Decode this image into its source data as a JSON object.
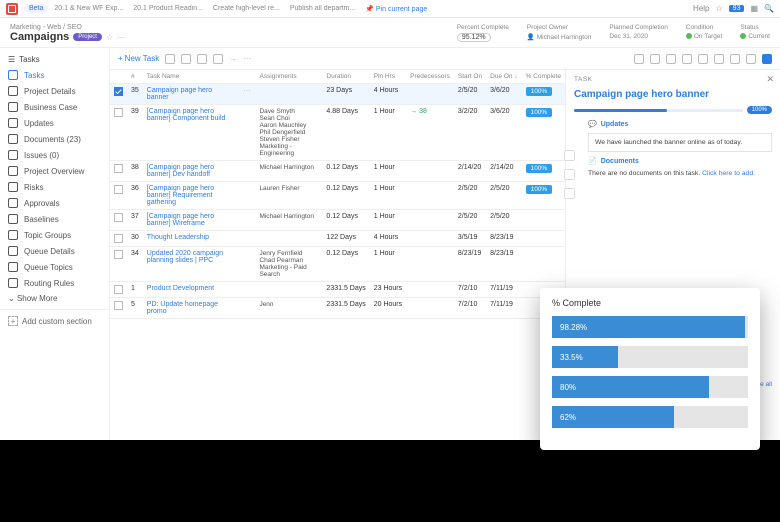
{
  "topbar": {
    "beta": "Beta",
    "tabs": [
      "20.1 & New WF Exp...",
      "20.1 Product Readin...",
      "Create high-level re...",
      "Publish all departm..."
    ],
    "pin": "Pin current page",
    "help": "Help",
    "notif_count": "93"
  },
  "header": {
    "crumbs": "Marketing - Web / SEO",
    "title": "Campaigns",
    "project_chip": "Project",
    "stats": {
      "percent_label": "Percent Complete",
      "percent_value": "95.12%",
      "owner_label": "Project Owner",
      "owner_value": "Michael Harrington",
      "planned_label": "Planned Completion",
      "planned_value": "Dec 31, 2020",
      "condition_label": "Condition",
      "condition_value": "On Target",
      "status_label": "Status",
      "status_value": "Current"
    }
  },
  "sidebar_head": "Tasks",
  "sidebar": {
    "items": [
      {
        "label": "Tasks",
        "active": true
      },
      {
        "label": "Project Details"
      },
      {
        "label": "Business Case"
      },
      {
        "label": "Updates"
      },
      {
        "label": "Documents (23)"
      },
      {
        "label": "Issues (0)"
      },
      {
        "label": "Project Overview"
      },
      {
        "label": "Risks"
      },
      {
        "label": "Approvals"
      },
      {
        "label": "Baselines"
      },
      {
        "label": "Topic Groups"
      },
      {
        "label": "Queue Details"
      },
      {
        "label": "Queue Topics"
      },
      {
        "label": "Routing Rules"
      }
    ],
    "show_more": "Show More",
    "add_section": "Add custom section"
  },
  "toolbar": {
    "new_task": "New Task"
  },
  "columns": [
    "",
    "#",
    "Task Name",
    "",
    "Assignments",
    "Duration",
    "Pln Hrs",
    "Predecessors",
    "Start On",
    "Due On ↓",
    "% Complete"
  ],
  "rows": [
    {
      "checked": true,
      "num": "35",
      "name": "Campaign page hero banner",
      "assign": "",
      "dur": "23 Days",
      "pln": "4 Hours",
      "pred": "",
      "start": "2/5/20",
      "due": "3/6/20",
      "pct": "100%"
    },
    {
      "num": "39",
      "name": "[Campaign page hero banner] Component build",
      "assign": "Dave Smyth · Sean Choi · Aaron Mauchley · Phil Dengerfield · Steven Fisher · Marketing - Engineering",
      "dur": "4.88 Days",
      "pln": "1 Hour",
      "pred": "→ 38",
      "start": "3/2/20",
      "due": "3/6/20",
      "pct": "100%"
    },
    {
      "num": "38",
      "name": "[Campaign page hero banner] Dev handoff",
      "assign": "Michael Harrington",
      "dur": "0.12 Days",
      "pln": "1 Hour",
      "pred": "",
      "start": "2/14/20",
      "due": "2/14/20",
      "pct": "100%"
    },
    {
      "num": "36",
      "name": "[Campaign page hero banner] Requirement gathering",
      "assign": "Lauren Fisher",
      "dur": "0.12 Days",
      "pln": "1 Hour",
      "pred": "",
      "start": "2/5/20",
      "due": "2/5/20",
      "pct": "100%"
    },
    {
      "num": "37",
      "name": "[Campaign page hero banner] Wireframe",
      "assign": "Michael Harrington",
      "dur": "0.12 Days",
      "pln": "1 Hour",
      "pred": "",
      "start": "2/5/20",
      "due": "2/5/20",
      "pct": ""
    },
    {
      "num": "30",
      "name": "Thought Leadership",
      "assign": "",
      "dur": "122 Days",
      "pln": "4 Hours",
      "pred": "",
      "start": "3/5/19",
      "due": "8/23/19",
      "pct": ""
    },
    {
      "num": "34",
      "name": "Updated 2020 campaign planning slides | PPC",
      "assign": "Jenry Fernfield · Chad Pearman · Marketing - Paid Search",
      "dur": "0.12 Days",
      "pln": "1 Hour",
      "pred": "",
      "start": "8/23/19",
      "due": "8/23/19",
      "pct": ""
    },
    {
      "num": "1",
      "name": "Product Development",
      "assign": "",
      "dur": "2331.5 Days",
      "pln": "23 Hours",
      "pred": "",
      "start": "7/2/10",
      "due": "7/11/19",
      "pct": ""
    },
    {
      "num": "5",
      "name": "PD: Update homepage promo",
      "assign": "Jenn",
      "dur": "2331.5 Days",
      "pln": "20 Hours",
      "pred": "",
      "start": "7/2/10",
      "due": "7/11/19",
      "pct": ""
    }
  ],
  "detail": {
    "kicker": "TASK",
    "title": "Campaign page hero banner",
    "progress": "100%",
    "updates_head": "Updates",
    "updates_body": "We have launched the banner online as of today.",
    "docs_head": "Documents",
    "docs_body": "There are no documents on this task. ",
    "docs_link": "Click here to add.",
    "see_all": "ee all"
  },
  "chart_data": {
    "type": "bar",
    "title": "% Complete",
    "categories": [
      "",
      "",
      "",
      ""
    ],
    "values": [
      98.28,
      33.5,
      80,
      62
    ],
    "labels": [
      "98.28%",
      "33.5%",
      "80%",
      "62%"
    ],
    "xlim": [
      0,
      100
    ]
  }
}
